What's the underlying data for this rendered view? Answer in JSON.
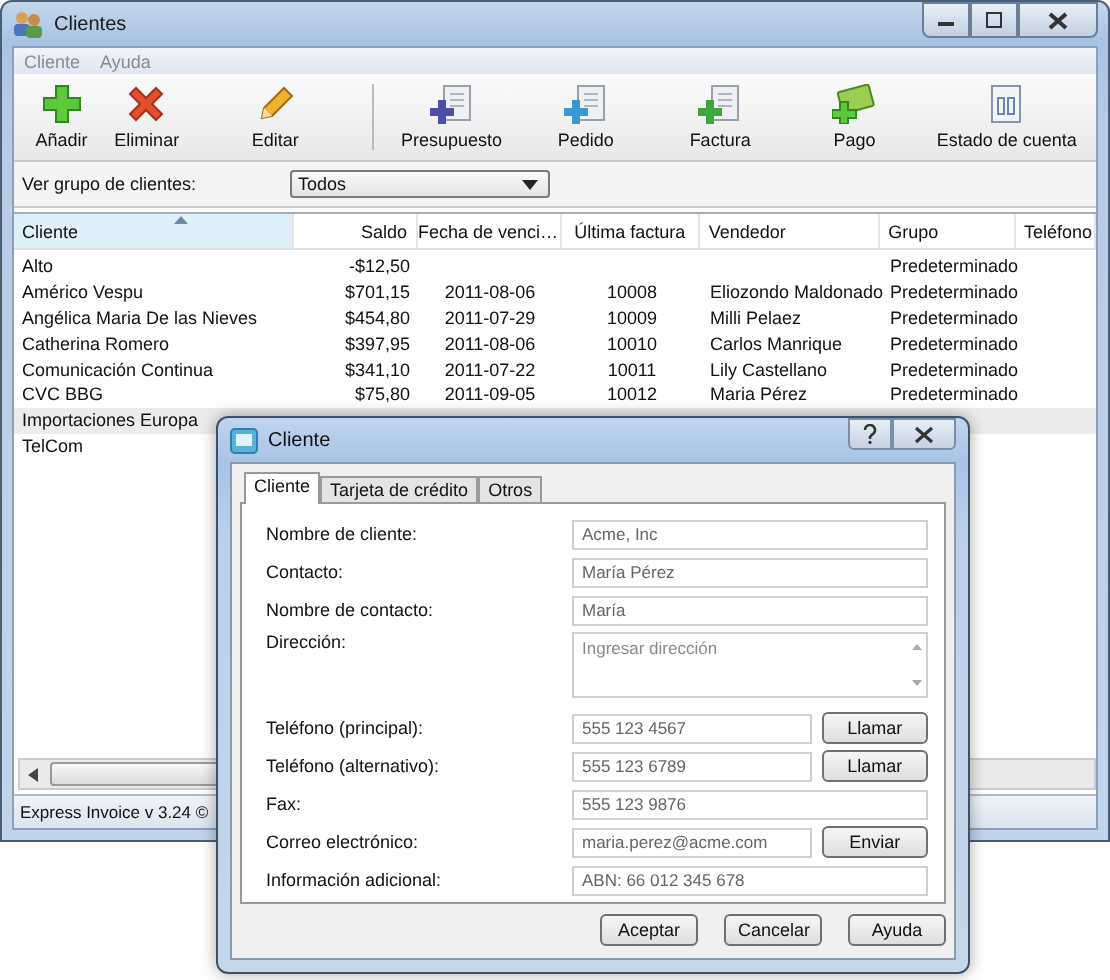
{
  "window": {
    "title": "Clientes"
  },
  "menu": [
    "Cliente",
    "Ayuda"
  ],
  "toolbar": [
    [
      {
        "label": "Añadir",
        "kind": "add"
      },
      {
        "label": "Eliminar",
        "kind": "delete"
      },
      {
        "label": "Editar",
        "kind": "edit"
      }
    ],
    [
      {
        "label": "Presupuesto",
        "kind": "quote"
      },
      {
        "label": "Pedido",
        "kind": "order"
      },
      {
        "label": "Factura",
        "kind": "invoice"
      },
      {
        "label": "Pago",
        "kind": "payment"
      },
      {
        "label": "Estado de cuenta",
        "kind": "statement"
      }
    ]
  ],
  "filter": {
    "label": "Ver grupo de clientes:",
    "value": "Todos"
  },
  "table": {
    "columns": [
      {
        "label": "Cliente",
        "kind": "text",
        "sorted": true
      },
      {
        "label": "Saldo",
        "kind": "money",
        "sorted": false
      },
      {
        "label": "Fecha de venci…",
        "kind": "center",
        "sorted": false
      },
      {
        "label": "Última factura",
        "kind": "center",
        "sorted": false
      },
      {
        "label": "Vendedor",
        "kind": "text",
        "sorted": false
      },
      {
        "label": "Grupo",
        "kind": "text",
        "sorted": false
      },
      {
        "label": "Teléfono",
        "kind": "text",
        "sorted": false
      }
    ],
    "rows": [
      {
        "selected": false,
        "cells": [
          "Alto",
          "-$12,50",
          null,
          null,
          null,
          "Predeterminado"
        ]
      },
      {
        "selected": false,
        "cells": [
          "Américo Vespu",
          "$701,15",
          "2011-08-06",
          "10008",
          "Eliozondo Maldonado",
          "Predeterminado"
        ]
      },
      {
        "selected": false,
        "cells": [
          "Angélica Maria De las Nieves",
          "$454,80",
          "2011-07-29",
          "10009",
          "Milli Pelaez",
          "Predeterminado"
        ]
      },
      {
        "selected": false,
        "cells": [
          "Catherina Romero",
          "$397,95",
          "2011-08-06",
          "10010",
          "Carlos Manrique",
          "Predeterminado"
        ]
      },
      {
        "selected": false,
        "cells": [
          "Comunicación Continua",
          "$341,10",
          "2011-07-22",
          "10011",
          "Lily Castellano",
          "Predeterminado"
        ]
      },
      {
        "selected": false,
        "cells": [
          "CVC BBG",
          "$75,80",
          "2011-09-05",
          "10012",
          "Maria Pérez",
          "Predeterminado"
        ]
      },
      {
        "selected": true,
        "cells": [
          "Importaciones Europa"
        ]
      },
      {
        "selected": false,
        "cells": [
          "TelCom"
        ]
      }
    ]
  },
  "status_bar": "Express Invoice v 3.24 ©",
  "dialog": {
    "title": "Cliente",
    "tabs": [
      {
        "label": "Cliente",
        "selected": true
      },
      {
        "label": "Tarjeta de crédito",
        "selected": false
      },
      {
        "label": "Otros",
        "selected": false
      }
    ],
    "fields": [
      {
        "kind": "text",
        "label": "Nombre de cliente:",
        "value": "Acme, Inc"
      },
      {
        "kind": "text",
        "label": "Contacto:",
        "value": "María Pérez"
      },
      {
        "kind": "text",
        "label": "Nombre de contacto:",
        "value": "María"
      },
      {
        "kind": "multiline",
        "label": "Dirección:",
        "placeholder": "Ingresar dirección"
      },
      {
        "kind": "text",
        "label": "Teléfono (principal):",
        "value": "555 123 4567",
        "button": "Llamar"
      },
      {
        "kind": "text",
        "label": "Teléfono (alternativo):",
        "value": "555 123 6789",
        "button": "Llamar"
      },
      {
        "kind": "text",
        "label": "Fax:",
        "value": "555 123 9876"
      },
      {
        "kind": "text",
        "label": "Correo electrónico:",
        "value": "maria.perez@acme.com",
        "button": "Enviar"
      },
      {
        "kind": "text",
        "label": "Información adicional:",
        "value": "ABN: 66 012 345 678"
      }
    ],
    "buttons": [
      "Aceptar",
      "Cancelar",
      "Ayuda"
    ]
  }
}
